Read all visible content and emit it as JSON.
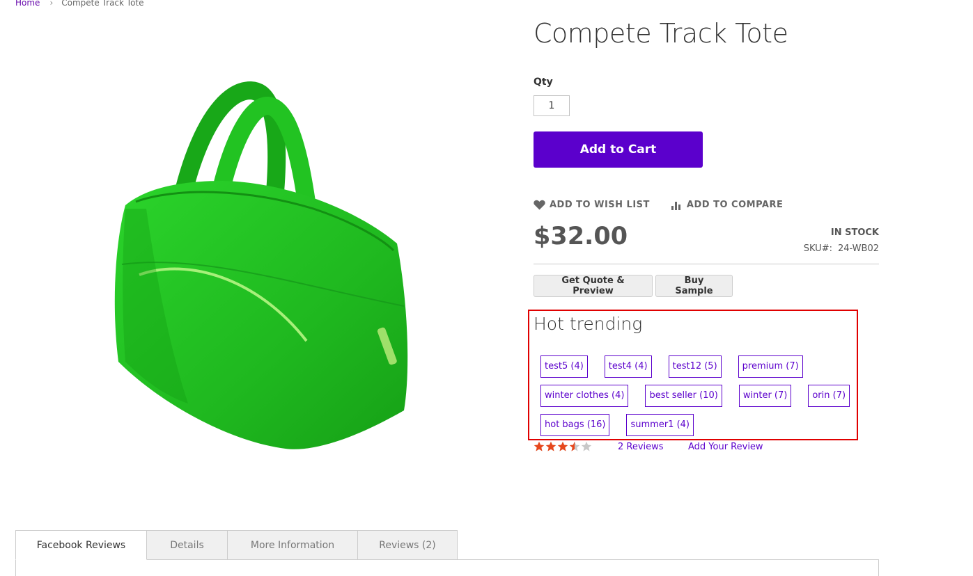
{
  "breadcrumb": {
    "home": "Home",
    "separator": "›",
    "current": "Compete Track Tote"
  },
  "product": {
    "title": "Compete Track Tote",
    "image_icon": "green-tote-bag",
    "qty_label": "Qty",
    "qty_value": "1",
    "add_to_cart_label": "Add to Cart",
    "wishlist_label": "ADD TO WISH LIST",
    "compare_label": "ADD TO COMPARE",
    "price": "$32.00",
    "stock": "IN STOCK",
    "sku_label": "SKU#:",
    "sku_value": "24-WB02",
    "quote_label": "Get Quote & Preview",
    "sample_label": "Buy Sample"
  },
  "trending": {
    "title": "Hot trending",
    "tags": [
      {
        "label": "test5 (4)"
      },
      {
        "label": "test4 (4)"
      },
      {
        "label": "test12 (5)"
      },
      {
        "label": "premium (7)"
      },
      {
        "label": "winter clothes (4)"
      },
      {
        "label": "best seller (10)"
      },
      {
        "label": "winter (7)"
      },
      {
        "label": "orin (7)"
      },
      {
        "label": "hot bags (16)"
      },
      {
        "label": "summer1 (4)"
      }
    ]
  },
  "reviews": {
    "rating_stars": 3.5,
    "rating_max": 5,
    "count_label": "2  Reviews",
    "add_review_label": "Add Your Review"
  },
  "tabs": [
    {
      "label": "Facebook Reviews",
      "active": true
    },
    {
      "label": "Details",
      "active": false
    },
    {
      "label": "More Information",
      "active": false
    },
    {
      "label": "Reviews (2)",
      "active": false
    }
  ],
  "colors": {
    "accent": "#5b00cc",
    "highlight_border": "#e00000",
    "star_filled": "#e6471c",
    "star_empty": "#c8c8c8",
    "bag_green": "#22c322"
  }
}
